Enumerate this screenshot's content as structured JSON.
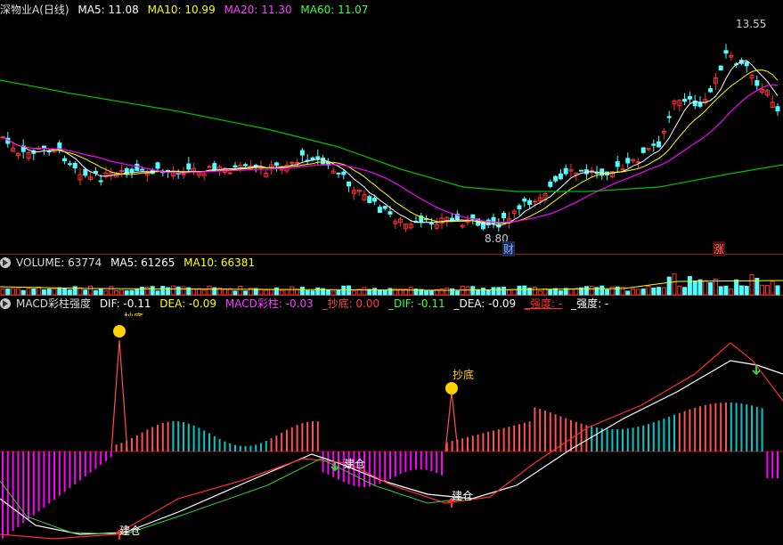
{
  "price_legend": {
    "title": "深物业A(日线)",
    "ma5": "MA5: 11.08",
    "ma10": "MA10: 10.99",
    "ma20": "MA20: 11.30",
    "ma60": "MA60: 11.07",
    "high_marker": "13.55",
    "low_marker": "8.80",
    "tag_cai": "财",
    "tag_zhang": "涨"
  },
  "volume_legend": {
    "volume": "VOLUME: 63774",
    "ma5": "MA5: 61265",
    "ma10": "MA10: 66381"
  },
  "macd_legend": {
    "title": "MACD彩柱强度",
    "dif": "DIF: -0.11",
    "dea": "DEA: -0.09",
    "macd": "MACD彩柱: -0.03",
    "chaodi": "_抄底: 0.00",
    "dif2": "_DIF: -0.11",
    "dea2": "_DEA: -0.09",
    "qiangdu_red": "_强度: -",
    "qiangdu_white": "_强度: -"
  },
  "signals": {
    "chaodi_label": "抄底",
    "jiancang_label": "建仓"
  },
  "colors": {
    "up": "#ff3232",
    "down": "#54ffff",
    "ma5": "#ffffff",
    "ma10": "#ffff00",
    "ma20": "#ff00ff",
    "ma60": "#00c000",
    "separator": "#a01818",
    "macd_pos": "#ff5050",
    "macd_neg": "#ff00ff",
    "macd_cyan": "#00c8c8",
    "dif_line": "#ffffff",
    "dea_line": "#ff3030"
  }
}
